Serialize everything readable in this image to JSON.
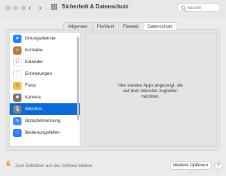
{
  "window": {
    "title": "Sicherheit & Datenschutz",
    "back_icon": "‹",
    "forward_icon": "›"
  },
  "search": {
    "placeholder": "Suchen"
  },
  "tabs": [
    {
      "label": "Allgemein"
    },
    {
      "label": "FileVault"
    },
    {
      "label": "Firewall"
    },
    {
      "label": "Datenschutz"
    }
  ],
  "privacy_list": {
    "items": [
      {
        "label": "Ortungsdienste",
        "icon": "location-arrow-icon",
        "color": "#1f84ff"
      },
      {
        "label": "Kontakte",
        "icon": "contacts-icon",
        "color": "#b67a49"
      },
      {
        "label": "Kalender",
        "icon": "calendar-icon",
        "color": "#ffffff"
      },
      {
        "label": "Erinnerungen",
        "icon": "reminders-icon",
        "color": "#ffffff"
      },
      {
        "label": "Fotos",
        "icon": "photos-icon",
        "color": "#f0c23a"
      },
      {
        "label": "Kamera",
        "icon": "camera-icon",
        "color": "#777777"
      },
      {
        "label": "Mikrofon",
        "icon": "microphone-icon",
        "color": "#7f7f7f"
      },
      {
        "label": "Spracherkennung",
        "icon": "speech-recognition-icon",
        "color": "#4c86ff"
      },
      {
        "label": "Bedienungshilfen",
        "icon": "accessibility-icon",
        "color": "#1e7bff"
      }
    ],
    "selected": "Mikrofon"
  },
  "detail": {
    "message": "Hier werden Apps angezeigt, die\nauf dein Mikrofon zugreifen\nmöchten."
  },
  "footer": {
    "lock_text": "Zum Schützen auf das Schloss klicken.",
    "more_button": "Weitere Optionen …",
    "help_button": "?"
  }
}
